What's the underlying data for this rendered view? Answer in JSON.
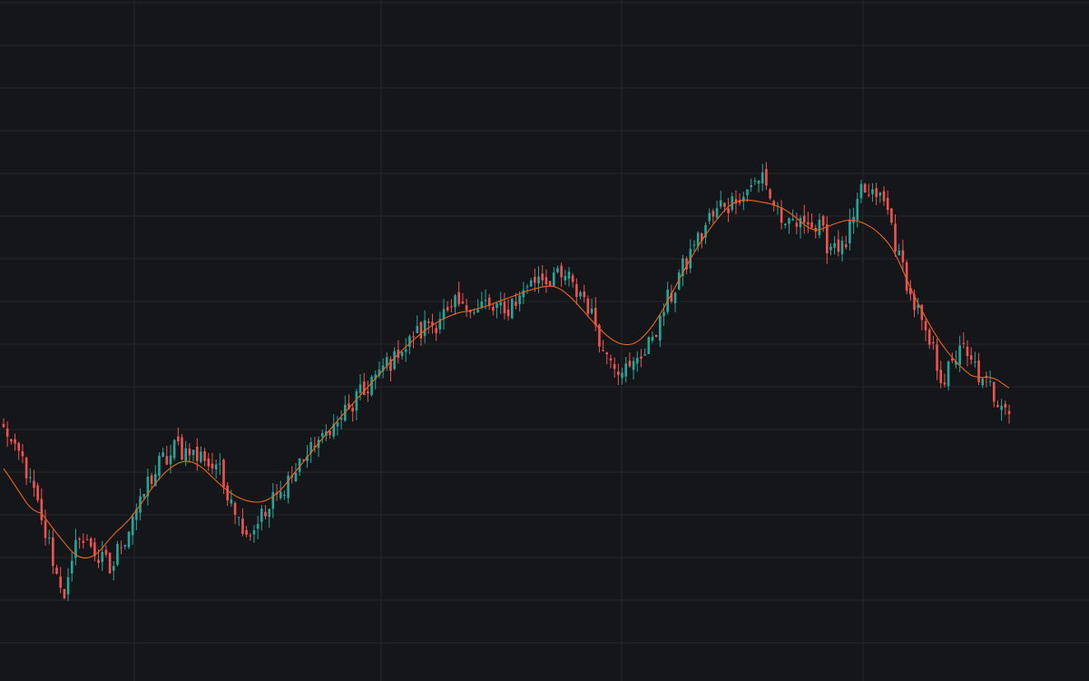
{
  "colors": {
    "background": "#151619",
    "grid": "#25262b",
    "up": "#26a69a",
    "down": "#ef5350",
    "ma": "#e5651e"
  },
  "chart_data": {
    "type": "candlestick",
    "grid": true,
    "x_axis_labels": false,
    "y_axis_labels": false,
    "index_range": [
      0,
      265
    ],
    "price_range": [
      5.0,
      6.5
    ],
    "anchor_closes": [
      [
        0,
        5.48
      ],
      [
        6,
        5.36
      ],
      [
        12,
        5.12
      ],
      [
        16,
        4.97
      ],
      [
        20,
        5.16
      ],
      [
        28,
        5.05
      ],
      [
        34,
        5.21
      ],
      [
        40,
        5.36
      ],
      [
        46,
        5.43
      ],
      [
        50,
        5.41
      ],
      [
        56,
        5.37
      ],
      [
        60,
        5.27
      ],
      [
        64,
        5.16
      ],
      [
        70,
        5.24
      ],
      [
        80,
        5.41
      ],
      [
        90,
        5.53
      ],
      [
        100,
        5.67
      ],
      [
        110,
        5.79
      ],
      [
        120,
        5.86
      ],
      [
        128,
        5.86
      ],
      [
        132,
        5.84
      ],
      [
        140,
        5.95
      ],
      [
        148,
        5.95
      ],
      [
        154,
        5.87
      ],
      [
        158,
        5.73
      ],
      [
        164,
        5.66
      ],
      [
        170,
        5.74
      ],
      [
        176,
        5.9
      ],
      [
        182,
        6.05
      ],
      [
        188,
        6.16
      ],
      [
        194,
        6.2
      ],
      [
        200,
        6.26
      ],
      [
        206,
        6.1
      ],
      [
        212,
        6.13
      ],
      [
        218,
        6.05
      ],
      [
        222,
        6.05
      ],
      [
        226,
        6.21
      ],
      [
        232,
        6.19
      ],
      [
        238,
        5.93
      ],
      [
        244,
        5.74
      ],
      [
        248,
        5.63
      ],
      [
        252,
        5.74
      ],
      [
        258,
        5.63
      ],
      [
        262,
        5.58
      ],
      [
        265,
        5.55
      ]
    ],
    "ma_window": 20
  }
}
